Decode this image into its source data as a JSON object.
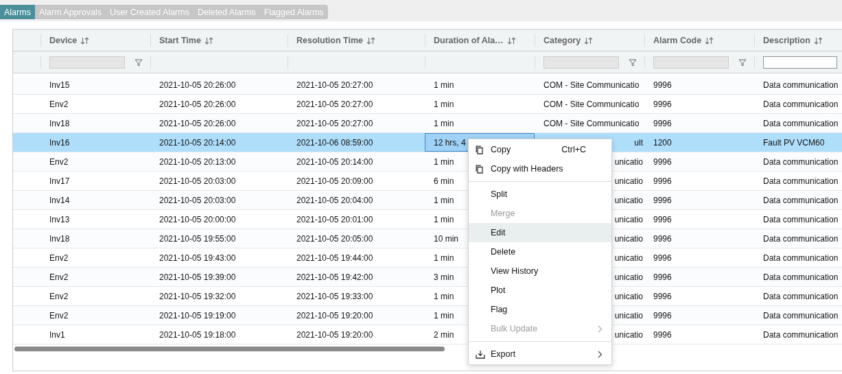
{
  "tabs": [
    {
      "label": "Alarms",
      "selected": true
    },
    {
      "label": "Alarm Approvals",
      "selected": false
    },
    {
      "label": "User Created Alarms",
      "selected": false
    },
    {
      "label": "Deleted Alarms",
      "selected": false
    },
    {
      "label": "Flagged Alarms",
      "selected": false
    }
  ],
  "table": {
    "columns": [
      {
        "label": "Device",
        "kind": "select"
      },
      {
        "label": "Start Time",
        "kind": "plain"
      },
      {
        "label": "Resolution Time",
        "kind": "plain"
      },
      {
        "label": "Duration of Ala…",
        "kind": "plain"
      },
      {
        "label": "Category",
        "kind": "select"
      },
      {
        "label": "Alarm Code",
        "kind": "select"
      },
      {
        "label": "Description",
        "kind": "input"
      }
    ],
    "rows": [
      {
        "cells": [
          "Inv15",
          "2021-10-05 20:26:00",
          "2021-10-05 20:27:00",
          "1 min",
          "COM - Site Communicatio",
          "9996",
          "Data communication"
        ],
        "selected": false,
        "covered": false,
        "duration_focused": false
      },
      {
        "cells": [
          "Env2",
          "2021-10-05 20:26:00",
          "2021-10-05 20:27:00",
          "1 min",
          "COM - Site Communicatio",
          "9996",
          "Data communication"
        ],
        "selected": false,
        "covered": false,
        "duration_focused": false
      },
      {
        "cells": [
          "Inv18",
          "2021-10-05 20:26:00",
          "2021-10-05 20:27:00",
          "1 min",
          "COM - Site Communicatio",
          "9996",
          "Data communication"
        ],
        "selected": false,
        "covered": false,
        "duration_focused": false
      },
      {
        "cells": [
          "Inv16",
          "2021-10-05 20:14:00",
          "2021-10-06 08:59:00",
          "12 hrs, 4",
          "ult",
          "1200",
          "Fault PV VCM60"
        ],
        "selected": true,
        "covered": true,
        "duration_focused": true
      },
      {
        "cells": [
          "Env2",
          "2021-10-05 20:13:00",
          "2021-10-05 20:14:00",
          "1 min",
          "unicatio",
          "9996",
          "Data communication"
        ],
        "selected": false,
        "covered": true,
        "duration_focused": false
      },
      {
        "cells": [
          "Inv17",
          "2021-10-05 20:03:00",
          "2021-10-05 20:09:00",
          "6 min",
          "unicatio",
          "9996",
          "Data communication"
        ],
        "selected": false,
        "covered": true,
        "duration_focused": false
      },
      {
        "cells": [
          "Inv14",
          "2021-10-05 20:03:00",
          "2021-10-05 20:04:00",
          "1 min",
          "unicatio",
          "9996",
          "Data communication"
        ],
        "selected": false,
        "covered": true,
        "duration_focused": false
      },
      {
        "cells": [
          "Inv13",
          "2021-10-05 20:00:00",
          "2021-10-05 20:01:00",
          "1 min",
          "unicatio",
          "9996",
          "Data communication"
        ],
        "selected": false,
        "covered": true,
        "duration_focused": false
      },
      {
        "cells": [
          "Inv18",
          "2021-10-05 19:55:00",
          "2021-10-05 20:05:00",
          "10 min",
          "unicatio",
          "9996",
          "Data communication"
        ],
        "selected": false,
        "covered": true,
        "duration_focused": false
      },
      {
        "cells": [
          "Env2",
          "2021-10-05 19:43:00",
          "2021-10-05 19:44:00",
          "1 min",
          "unicatio",
          "9996",
          "Data communication"
        ],
        "selected": false,
        "covered": true,
        "duration_focused": false
      },
      {
        "cells": [
          "Env2",
          "2021-10-05 19:39:00",
          "2021-10-05 19:42:00",
          "3 min",
          "unicatio",
          "9996",
          "Data communication"
        ],
        "selected": false,
        "covered": true,
        "duration_focused": false
      },
      {
        "cells": [
          "Env2",
          "2021-10-05 19:32:00",
          "2021-10-05 19:33:00",
          "1 min",
          "unicatio",
          "9996",
          "Data communication"
        ],
        "selected": false,
        "covered": true,
        "duration_focused": false
      },
      {
        "cells": [
          "Env2",
          "2021-10-05 19:19:00",
          "2021-10-05 19:20:00",
          "1 min",
          "unicatio",
          "9996",
          "Data communication"
        ],
        "selected": false,
        "covered": true,
        "duration_focused": false
      },
      {
        "cells": [
          "Inv1",
          "2021-10-05 19:18:00",
          "2021-10-05 19:20:00",
          "2 min",
          "unicatio",
          "9996",
          "Data communication"
        ],
        "selected": false,
        "covered": true,
        "duration_focused": false
      }
    ]
  },
  "context_menu": [
    {
      "kind": "copy",
      "label": "Copy",
      "shortcut": "Ctrl+C",
      "disabled": false,
      "highlighted": false,
      "submenu": false
    },
    {
      "kind": "copy",
      "label": "Copy with Headers",
      "disabled": false,
      "highlighted": false,
      "submenu": false
    },
    {
      "kind": "divider"
    },
    {
      "kind": "plain",
      "label": "Split",
      "disabled": false,
      "highlighted": false,
      "submenu": false
    },
    {
      "kind": "plain",
      "label": "Merge",
      "disabled": true,
      "highlighted": false,
      "submenu": false
    },
    {
      "kind": "plain",
      "label": "Edit",
      "disabled": false,
      "highlighted": true,
      "submenu": false
    },
    {
      "kind": "plain",
      "label": "Delete",
      "disabled": false,
      "highlighted": false,
      "submenu": false
    },
    {
      "kind": "plain",
      "label": "View History",
      "disabled": false,
      "highlighted": false,
      "submenu": false
    },
    {
      "kind": "plain",
      "label": "Plot",
      "disabled": false,
      "highlighted": false,
      "submenu": false
    },
    {
      "kind": "plain",
      "label": "Flag",
      "disabled": false,
      "highlighted": false,
      "submenu": false
    },
    {
      "kind": "plain",
      "label": "Bulk Update",
      "disabled": true,
      "highlighted": false,
      "submenu": true
    },
    {
      "kind": "divider"
    },
    {
      "kind": "export",
      "label": "Export",
      "disabled": false,
      "highlighted": false,
      "submenu": true
    }
  ]
}
